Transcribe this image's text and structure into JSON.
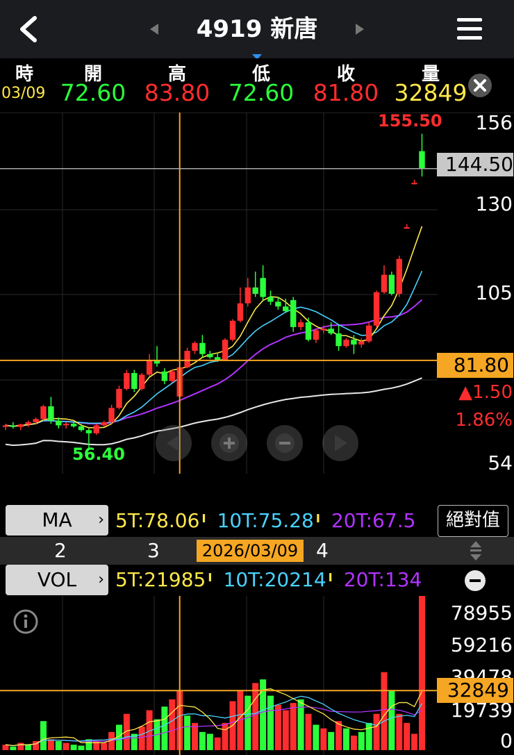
{
  "header": {
    "title": "4919 新唐",
    "back_icon": "chevron-left-icon",
    "prev_icon": "triangle-left-icon",
    "next_icon": "triangle-right-icon",
    "menu_icon": "hamburger-menu-icon"
  },
  "ohlc": {
    "labels": {
      "time": "時",
      "open": "開",
      "high": "高",
      "low": "低",
      "close": "收",
      "volume": "量"
    },
    "date": "03/09",
    "open": "72.60",
    "high": "83.80",
    "low": "72.60",
    "close": "81.80",
    "volume": "32849",
    "close_icon": "close-icon"
  },
  "price_axis": {
    "labels": [
      "156",
      "130",
      "105",
      "54"
    ],
    "cursor_price": "144.50",
    "last_price": "81.80",
    "change": "▲1.50",
    "change_pct": "1.86%"
  },
  "annotations": {
    "high_label": "155.50",
    "low_label": "56.40"
  },
  "controls": {
    "left_icon": "arrow-left-icon",
    "zoom_in_icon": "zoom-in-icon",
    "zoom_out_icon": "zoom-out-icon",
    "right_icon": "arrow-right-icon"
  },
  "ma_bar": {
    "label": "MA",
    "ma5": "5T:78.06",
    "ma10": "10T:75.28",
    "ma20": "20T:67.5",
    "absolute_button": "絕對值"
  },
  "date_strip": {
    "ticks": [
      "2",
      "3",
      "4"
    ],
    "cursor_date": "2026/03/09"
  },
  "vol_bar": {
    "label": "VOL",
    "ma5": "5T:21985",
    "ma10": "10T:20214",
    "ma20": "20T:134"
  },
  "vol_axis": {
    "labels": [
      "78955",
      "59216",
      "39478",
      "19739",
      "0"
    ],
    "cursor_value": "32849"
  },
  "colors": {
    "up": "#ff2d2d",
    "down": "#2bff3b",
    "ma5": "#ffe84a",
    "ma10": "#4ad2ff",
    "ma20": "#b233ff",
    "ma60": "#e8e8e8",
    "cursor": "#f5a623"
  },
  "chart_data": {
    "type": "candlestick",
    "candles": [
      {
        "o": 63.0,
        "h": 64.0,
        "l": 62.0,
        "c": 63.5
      },
      {
        "o": 63.5,
        "h": 64.5,
        "l": 62.5,
        "c": 63.0
      },
      {
        "o": 63.0,
        "h": 64.0,
        "l": 62.0,
        "c": 63.8
      },
      {
        "o": 63.8,
        "h": 65.0,
        "l": 63.0,
        "c": 64.5
      },
      {
        "o": 64.5,
        "h": 66.0,
        "l": 64.0,
        "c": 65.5
      },
      {
        "o": 65.5,
        "h": 70.0,
        "l": 65.0,
        "c": 69.5
      },
      {
        "o": 69.5,
        "h": 72.5,
        "l": 64.0,
        "c": 65.0
      },
      {
        "o": 65.0,
        "h": 66.0,
        "l": 62.5,
        "c": 63.5
      },
      {
        "o": 63.5,
        "h": 64.5,
        "l": 62.5,
        "c": 64.0
      },
      {
        "o": 64.0,
        "h": 64.8,
        "l": 62.8,
        "c": 63.2
      },
      {
        "o": 63.2,
        "h": 64.0,
        "l": 61.5,
        "c": 62.0
      },
      {
        "o": 62.0,
        "h": 62.5,
        "l": 56.4,
        "c": 61.0
      },
      {
        "o": 61.0,
        "h": 64.0,
        "l": 60.5,
        "c": 63.5
      },
      {
        "o": 63.5,
        "h": 65.0,
        "l": 63.0,
        "c": 64.5
      },
      {
        "o": 64.5,
        "h": 70.0,
        "l": 64.0,
        "c": 69.0
      },
      {
        "o": 69.0,
        "h": 76.0,
        "l": 68.5,
        "c": 75.0
      },
      {
        "o": 75.0,
        "h": 81.0,
        "l": 74.5,
        "c": 80.0
      },
      {
        "o": 80.0,
        "h": 81.0,
        "l": 74.0,
        "c": 75.0
      },
      {
        "o": 75.0,
        "h": 80.0,
        "l": 74.5,
        "c": 79.5
      },
      {
        "o": 79.5,
        "h": 86.0,
        "l": 79.0,
        "c": 84.0
      },
      {
        "o": 84.0,
        "h": 88.5,
        "l": 82.0,
        "c": 83.0
      },
      {
        "o": 80.5,
        "h": 81.5,
        "l": 76.5,
        "c": 77.5
      },
      {
        "o": 77.5,
        "h": 81.0,
        "l": 77.0,
        "c": 80.5
      },
      {
        "o": 72.6,
        "h": 83.8,
        "l": 72.6,
        "c": 81.8
      },
      {
        "o": 81.8,
        "h": 88.0,
        "l": 81.5,
        "c": 87.0
      },
      {
        "o": 87.0,
        "h": 90.0,
        "l": 86.0,
        "c": 89.5
      },
      {
        "o": 89.5,
        "h": 92.0,
        "l": 85.0,
        "c": 86.0
      },
      {
        "o": 86.0,
        "h": 87.0,
        "l": 84.5,
        "c": 85.0
      },
      {
        "o": 85.0,
        "h": 86.5,
        "l": 83.5,
        "c": 84.2
      },
      {
        "o": 84.2,
        "h": 91.0,
        "l": 84.0,
        "c": 90.5
      },
      {
        "o": 90.5,
        "h": 97.0,
        "l": 90.0,
        "c": 96.5
      },
      {
        "o": 96.5,
        "h": 107.0,
        "l": 96.0,
        "c": 102.0
      },
      {
        "o": 102.0,
        "h": 110.0,
        "l": 101.0,
        "c": 107.0
      },
      {
        "o": 107.0,
        "h": 112.0,
        "l": 104.0,
        "c": 105.0
      },
      {
        "o": 110.0,
        "h": 114.0,
        "l": 103.0,
        "c": 104.0
      },
      {
        "o": 104.0,
        "h": 106.0,
        "l": 101.5,
        "c": 102.5
      },
      {
        "o": 102.5,
        "h": 104.0,
        "l": 100.0,
        "c": 101.0
      },
      {
        "o": 101.0,
        "h": 103.5,
        "l": 99.0,
        "c": 99.5
      },
      {
        "o": 103.0,
        "h": 104.0,
        "l": 93.0,
        "c": 94.5
      },
      {
        "o": 94.5,
        "h": 97.0,
        "l": 93.5,
        "c": 96.0
      },
      {
        "o": 96.0,
        "h": 97.5,
        "l": 90.0,
        "c": 90.5
      },
      {
        "o": 90.5,
        "h": 94.0,
        "l": 89.5,
        "c": 93.5
      },
      {
        "o": 93.5,
        "h": 95.0,
        "l": 92.5,
        "c": 94.0
      },
      {
        "o": 94.0,
        "h": 96.0,
        "l": 92.0,
        "c": 92.5
      },
      {
        "o": 92.5,
        "h": 95.0,
        "l": 87.0,
        "c": 88.5
      },
      {
        "o": 88.5,
        "h": 91.0,
        "l": 88.0,
        "c": 90.5
      },
      {
        "o": 90.5,
        "h": 92.0,
        "l": 86.0,
        "c": 89.0
      },
      {
        "o": 89.0,
        "h": 91.0,
        "l": 88.0,
        "c": 90.0
      },
      {
        "o": 90.0,
        "h": 96.0,
        "l": 89.5,
        "c": 95.0
      },
      {
        "o": 95.0,
        "h": 106.0,
        "l": 94.5,
        "c": 105.5
      },
      {
        "o": 105.5,
        "h": 114.0,
        "l": 105.0,
        "c": 111.0
      },
      {
        "o": 111.0,
        "h": 112.0,
        "l": 104.5,
        "c": 105.0
      },
      {
        "o": 105.0,
        "h": 117.0,
        "l": 104.0,
        "c": 116.0
      },
      {
        "o": 126.0,
        "h": 127.0,
        "l": 125.5,
        "c": 126.0
      },
      {
        "o": 140.0,
        "h": 141.0,
        "l": 139.5,
        "c": 140.0
      },
      {
        "o": 150.0,
        "h": 155.5,
        "l": 142.0,
        "c": 144.5
      }
    ],
    "volumes": [
      {
        "v": 3000,
        "up": true
      },
      {
        "v": 2000,
        "up": false
      },
      {
        "v": 4000,
        "up": true
      },
      {
        "v": 3000,
        "up": false
      },
      {
        "v": 5000,
        "up": true
      },
      {
        "v": 16000,
        "up": false
      },
      {
        "v": 6000,
        "up": true
      },
      {
        "v": 5000,
        "up": false
      },
      {
        "v": 4000,
        "up": true
      },
      {
        "v": 3000,
        "up": false
      },
      {
        "v": 2500,
        "up": false
      },
      {
        "v": 6000,
        "up": false
      },
      {
        "v": 5000,
        "up": true
      },
      {
        "v": 4000,
        "up": true
      },
      {
        "v": 10000,
        "up": true
      },
      {
        "v": 14000,
        "up": false
      },
      {
        "v": 20000,
        "up": true
      },
      {
        "v": 9000,
        "up": false
      },
      {
        "v": 13000,
        "up": true
      },
      {
        "v": 22000,
        "up": true
      },
      {
        "v": 17000,
        "up": false
      },
      {
        "v": 24000,
        "up": false
      },
      {
        "v": 28000,
        "up": true
      },
      {
        "v": 32849,
        "up": true
      },
      {
        "v": 19000,
        "up": false
      },
      {
        "v": 15000,
        "up": true
      },
      {
        "v": 10000,
        "up": false
      },
      {
        "v": 9000,
        "up": false
      },
      {
        "v": 7000,
        "up": true
      },
      {
        "v": 15000,
        "up": true
      },
      {
        "v": 27000,
        "up": true
      },
      {
        "v": 33000,
        "up": true
      },
      {
        "v": 30000,
        "up": false
      },
      {
        "v": 37000,
        "up": true
      },
      {
        "v": 39000,
        "up": false
      },
      {
        "v": 30000,
        "up": false
      },
      {
        "v": 25000,
        "up": true
      },
      {
        "v": 22000,
        "up": true
      },
      {
        "v": 26000,
        "up": true
      },
      {
        "v": 28000,
        "up": false
      },
      {
        "v": 20000,
        "up": true
      },
      {
        "v": 14000,
        "up": false
      },
      {
        "v": 12000,
        "up": true
      },
      {
        "v": 10000,
        "up": false
      },
      {
        "v": 16000,
        "up": true
      },
      {
        "v": 12000,
        "up": false
      },
      {
        "v": 8000,
        "up": true
      },
      {
        "v": 10000,
        "up": false
      },
      {
        "v": 15000,
        "up": false
      },
      {
        "v": 20000,
        "up": true
      },
      {
        "v": 43000,
        "up": true
      },
      {
        "v": 33000,
        "up": false
      },
      {
        "v": 20000,
        "up": true
      },
      {
        "v": 15000,
        "up": true
      },
      {
        "v": 9000,
        "up": true
      },
      {
        "v": 85000,
        "up": true
      }
    ],
    "price_range": [
      50,
      160
    ],
    "volume_range": [
      0,
      85000
    ],
    "cursor_index": 23,
    "cursor_price": 144.5
  }
}
